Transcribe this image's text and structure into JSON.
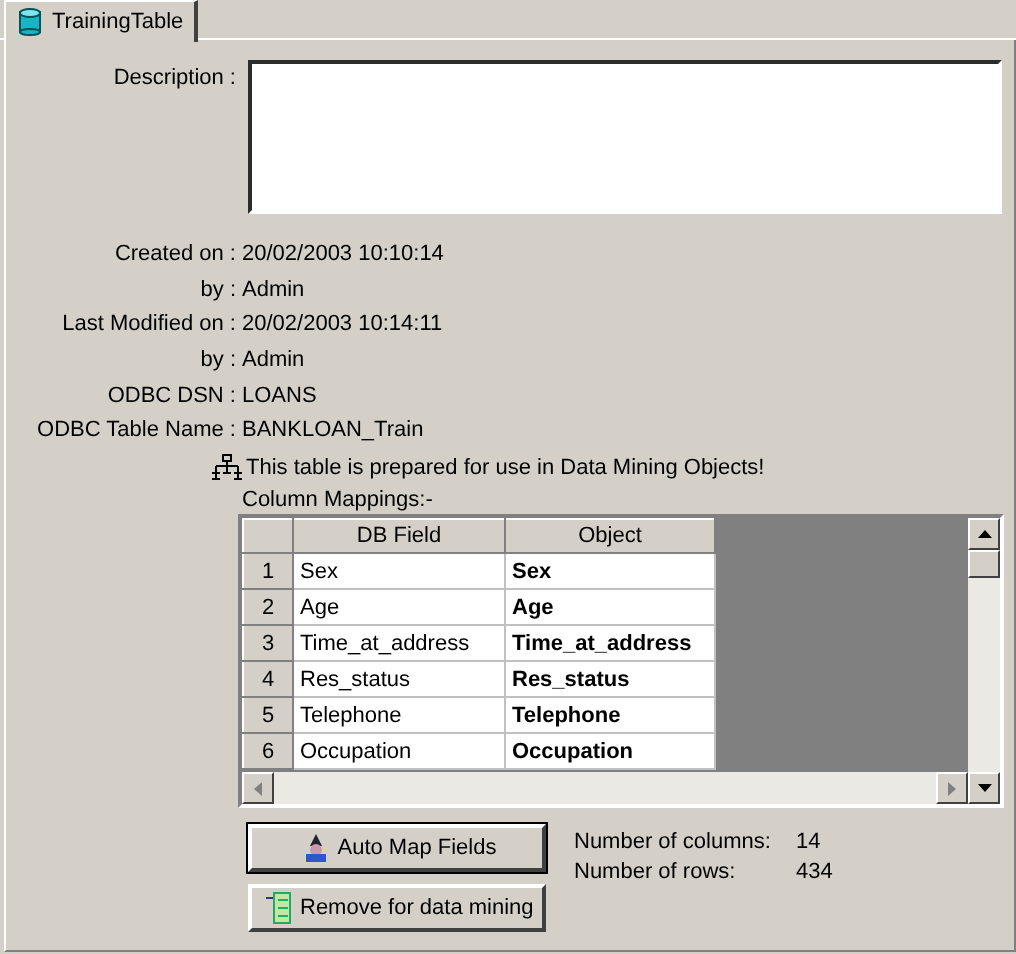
{
  "tabs": [
    {
      "label": "TrainingTable",
      "selected": true
    }
  ],
  "description": {
    "label": "Description :"
  },
  "properties": [
    {
      "label": "Created on :",
      "value": "20/02/2003 10:10:14"
    },
    {
      "label": "by :",
      "value": "Admin"
    },
    {
      "label": "Last Modified on :",
      "value": "20/02/2003 10:14:11"
    },
    {
      "label": "by :",
      "value": "Admin"
    },
    {
      "label": "ODBC DSN :",
      "value": "LOANS"
    },
    {
      "label": "ODBC Table Name :",
      "value": "BANKLOAN_Train"
    }
  ],
  "notice": "This table is prepared for use in Data Mining Objects!",
  "mappings": {
    "label": "Column Mappings:-",
    "columns": [
      "DB Field",
      "Object"
    ],
    "rows": [
      {
        "num": "1",
        "field": "Sex",
        "object": "Sex"
      },
      {
        "num": "2",
        "field": "Age",
        "object": "Age"
      },
      {
        "num": "3",
        "field": "Time_at_address",
        "object": "Time_at_address"
      },
      {
        "num": "4",
        "field": "Res_status",
        "object": "Res_status"
      },
      {
        "num": "5",
        "field": "Telephone",
        "object": "Telephone"
      },
      {
        "num": "6",
        "field": "Occupation",
        "object": "Occupation"
      }
    ]
  },
  "buttons": [
    {
      "label": "Auto Map Fields",
      "kind": "automap"
    },
    {
      "label": "Remove for data mining",
      "kind": "remove"
    }
  ],
  "stats": [
    {
      "label": "Number of columns:",
      "value": "14"
    },
    {
      "label": "Number of rows:",
      "value": "434"
    }
  ]
}
